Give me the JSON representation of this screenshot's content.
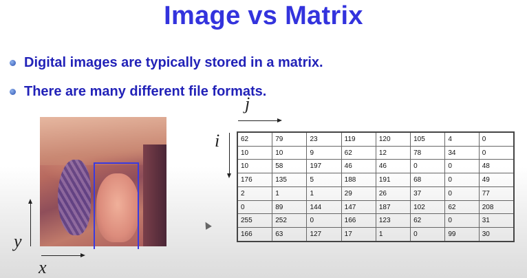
{
  "slide": {
    "title": "Image vs Matrix",
    "bullets": [
      "Digital images are typically stored in a matrix.",
      "There are many different file formats."
    ]
  },
  "axes": {
    "image_y": "y",
    "image_x": "x",
    "matrix_i": "i",
    "matrix_j": "j"
  },
  "matrix": {
    "rows": [
      [
        "62",
        "79",
        "23",
        "119",
        "120",
        "105",
        "4",
        "0"
      ],
      [
        "10",
        "10",
        "9",
        "62",
        "12",
        "78",
        "34",
        "0"
      ],
      [
        "10",
        "58",
        "197",
        "46",
        "46",
        "0",
        "0",
        "48"
      ],
      [
        "176",
        "135",
        "5",
        "188",
        "191",
        "68",
        "0",
        "49"
      ],
      [
        "2",
        "1",
        "1",
        "29",
        "26",
        "37",
        "0",
        "77"
      ],
      [
        "0",
        "89",
        "144",
        "147",
        "187",
        "102",
        "62",
        "208"
      ],
      [
        "255",
        "252",
        "0",
        "166",
        "123",
        "62",
        "0",
        "31"
      ],
      [
        "166",
        "63",
        "127",
        "17",
        "1",
        "0",
        "99",
        "30"
      ]
    ]
  },
  "colors": {
    "title": "#3333dd",
    "bullet_text": "#2222b8",
    "roi_box": "#3a3ae0"
  }
}
